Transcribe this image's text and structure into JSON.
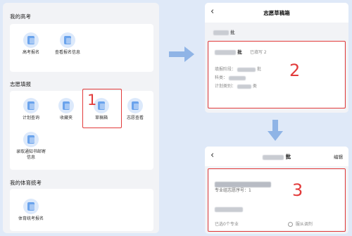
{
  "left": {
    "section1_title": "我的高考",
    "section1_items": [
      "高考报名",
      "查看报名信息"
    ],
    "section2_title": "志愿填报",
    "section2_items": [
      "计划查询",
      "收藏夹",
      "草稿箱",
      "志愿查看"
    ],
    "section2_row2_items": [
      "录取通知书邮寄信息"
    ],
    "section3_title": "我的体育统考",
    "section3_items": [
      "体育统考报名"
    ],
    "step_label": "1"
  },
  "screen1": {
    "title": "志愿草稿箱",
    "batch_suffix": "批",
    "card_batch_suffix": "批",
    "filled_label": "已填写 2",
    "row_labels": [
      "填报阶段：",
      "科类：",
      "计划类别："
    ],
    "row_suffixes": [
      "批",
      "",
      "类"
    ],
    "step_label": "2"
  },
  "screen2": {
    "title_suffix": "批",
    "edit_label": "编辑",
    "group_seq_label": "专业组志愿序号：1",
    "selected_label": "已选0个专业",
    "adjust_label": "服从调剂",
    "step_label": "3"
  },
  "colors": {
    "background": "#dfe9f8",
    "accent_red": "#e23b3b",
    "arrow_blue": "#8fb4e6",
    "icon_blue": "#6aa3ec"
  }
}
